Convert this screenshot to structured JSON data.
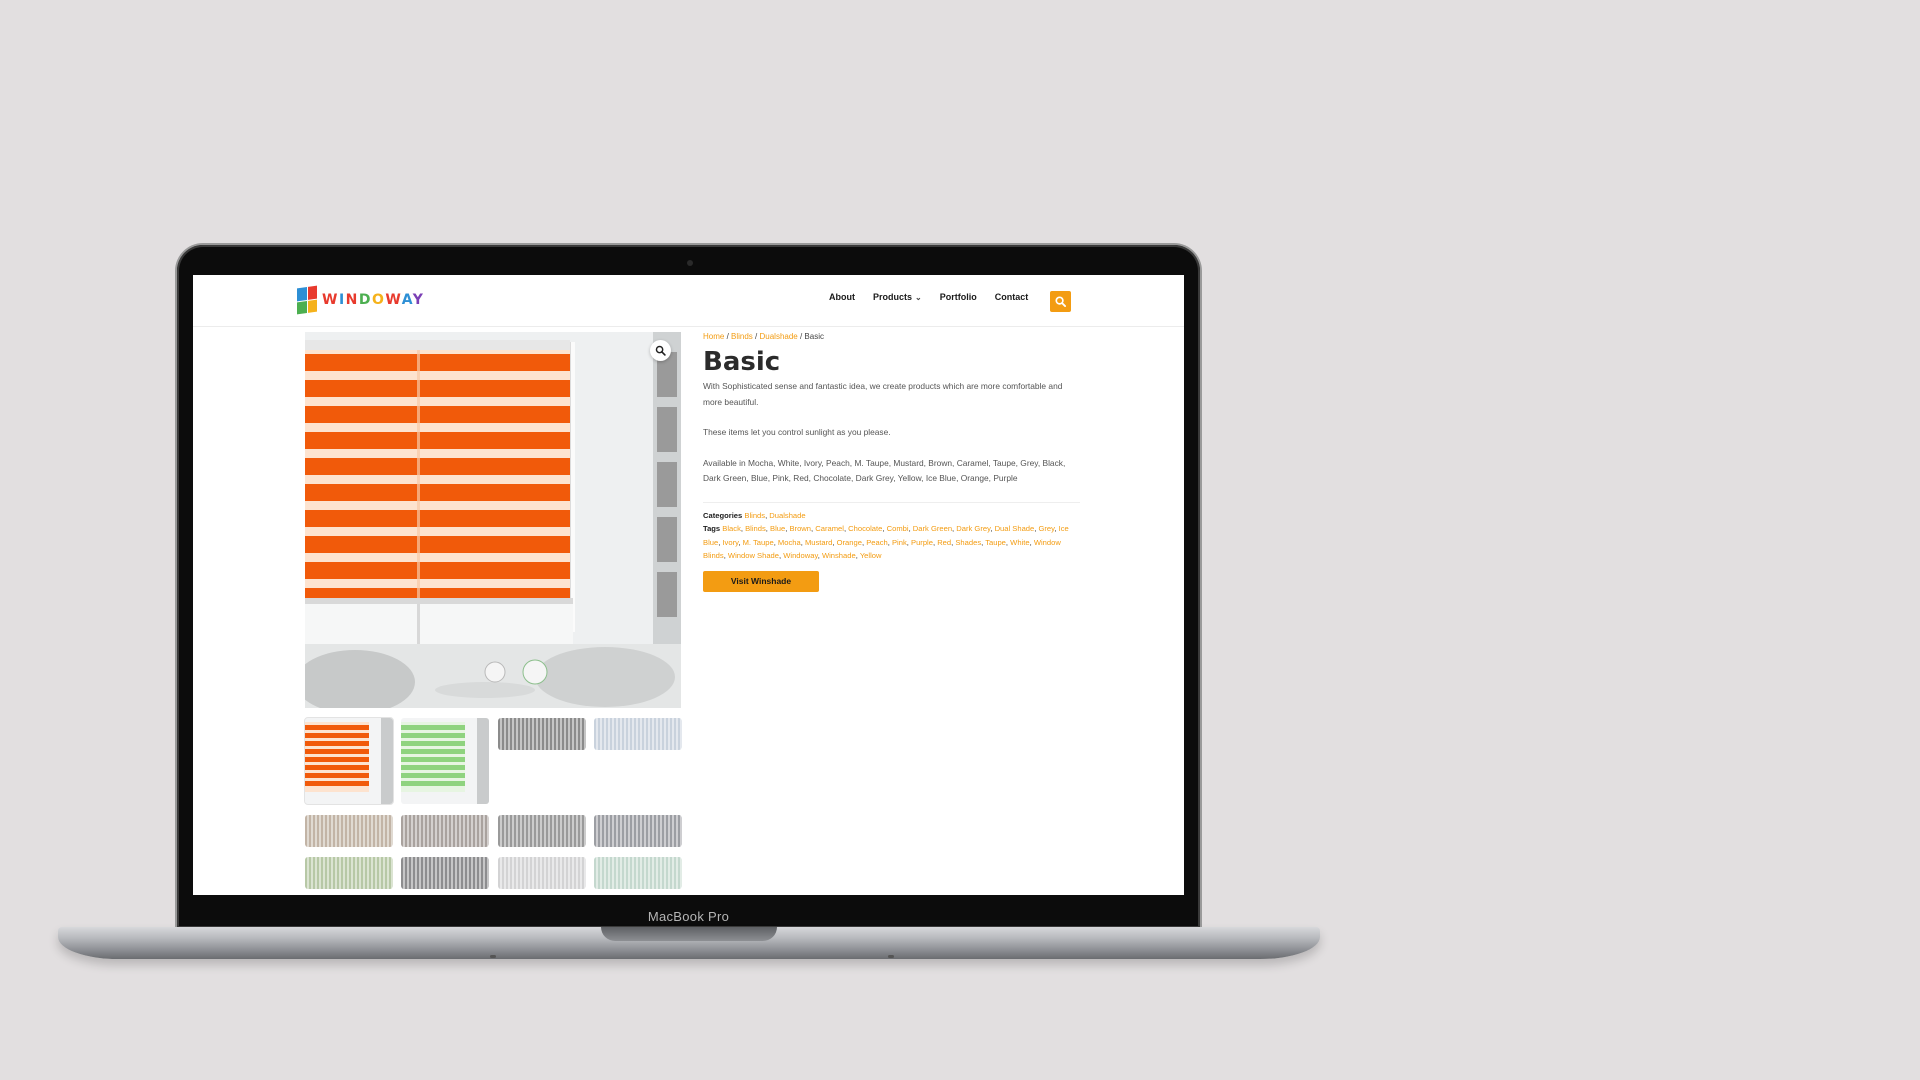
{
  "device": {
    "label": "MacBook Pro"
  },
  "header": {
    "logo_text": "WINDOWAY",
    "nav": [
      {
        "label": "About"
      },
      {
        "label": "Products",
        "has_dropdown": true
      },
      {
        "label": "Portfolio"
      },
      {
        "label": "Contact"
      }
    ],
    "search_icon": "search-icon"
  },
  "breadcrumb": {
    "home": "Home",
    "sep": " / ",
    "blinds": "Blinds",
    "dualshade": "Dualshade",
    "current": "Basic"
  },
  "product": {
    "title": "Basic",
    "desc1": "With Sophisticated sense and fantastic idea, we create products which are more comfortable and more beautiful.",
    "desc2": "These items let you control sunlight as you please.",
    "desc3": "Available in Mocha, White, Ivory, Peach, M. Taupe, Mustard, Brown, Caramel, Taupe, Grey, Black, Dark Green, Blue, Pink, Red, Chocolate, Dark Grey, Yellow, Ice Blue, Orange, Purple",
    "categories_label": "Categories",
    "categories": [
      "Blinds",
      "Dualshade"
    ],
    "tags_label": "Tags",
    "tags": [
      "Black",
      "Blinds",
      "Blue",
      "Brown",
      "Caramel",
      "Chocolate",
      "Combi",
      "Dark Green",
      "Dark Grey",
      "Dual Shade",
      "Grey",
      "Ice Blue",
      "Ivory",
      "M. Taupe",
      "Mocha",
      "Mustard",
      "Orange",
      "Peach",
      "Pink",
      "Purple",
      "Red",
      "Shades",
      "Taupe",
      "White",
      "Window Blinds",
      "Window Shade",
      "Windoway",
      "Winshade",
      "Yellow"
    ],
    "button_label": "Visit Winshade"
  },
  "colors": {
    "accent": "#f39c12",
    "blind_orange": "#f15a0a",
    "thumb_green": "#8fd37f"
  },
  "swatches": [
    "#8b8b8b",
    "#c9d2dd",
    "#c2b4a6",
    "#a9a29e",
    "#9a9a9a",
    "#9c9ea3",
    "#b7c8a6",
    "#8d8d8f",
    "#d3d3d4",
    "#c4d8ce"
  ]
}
